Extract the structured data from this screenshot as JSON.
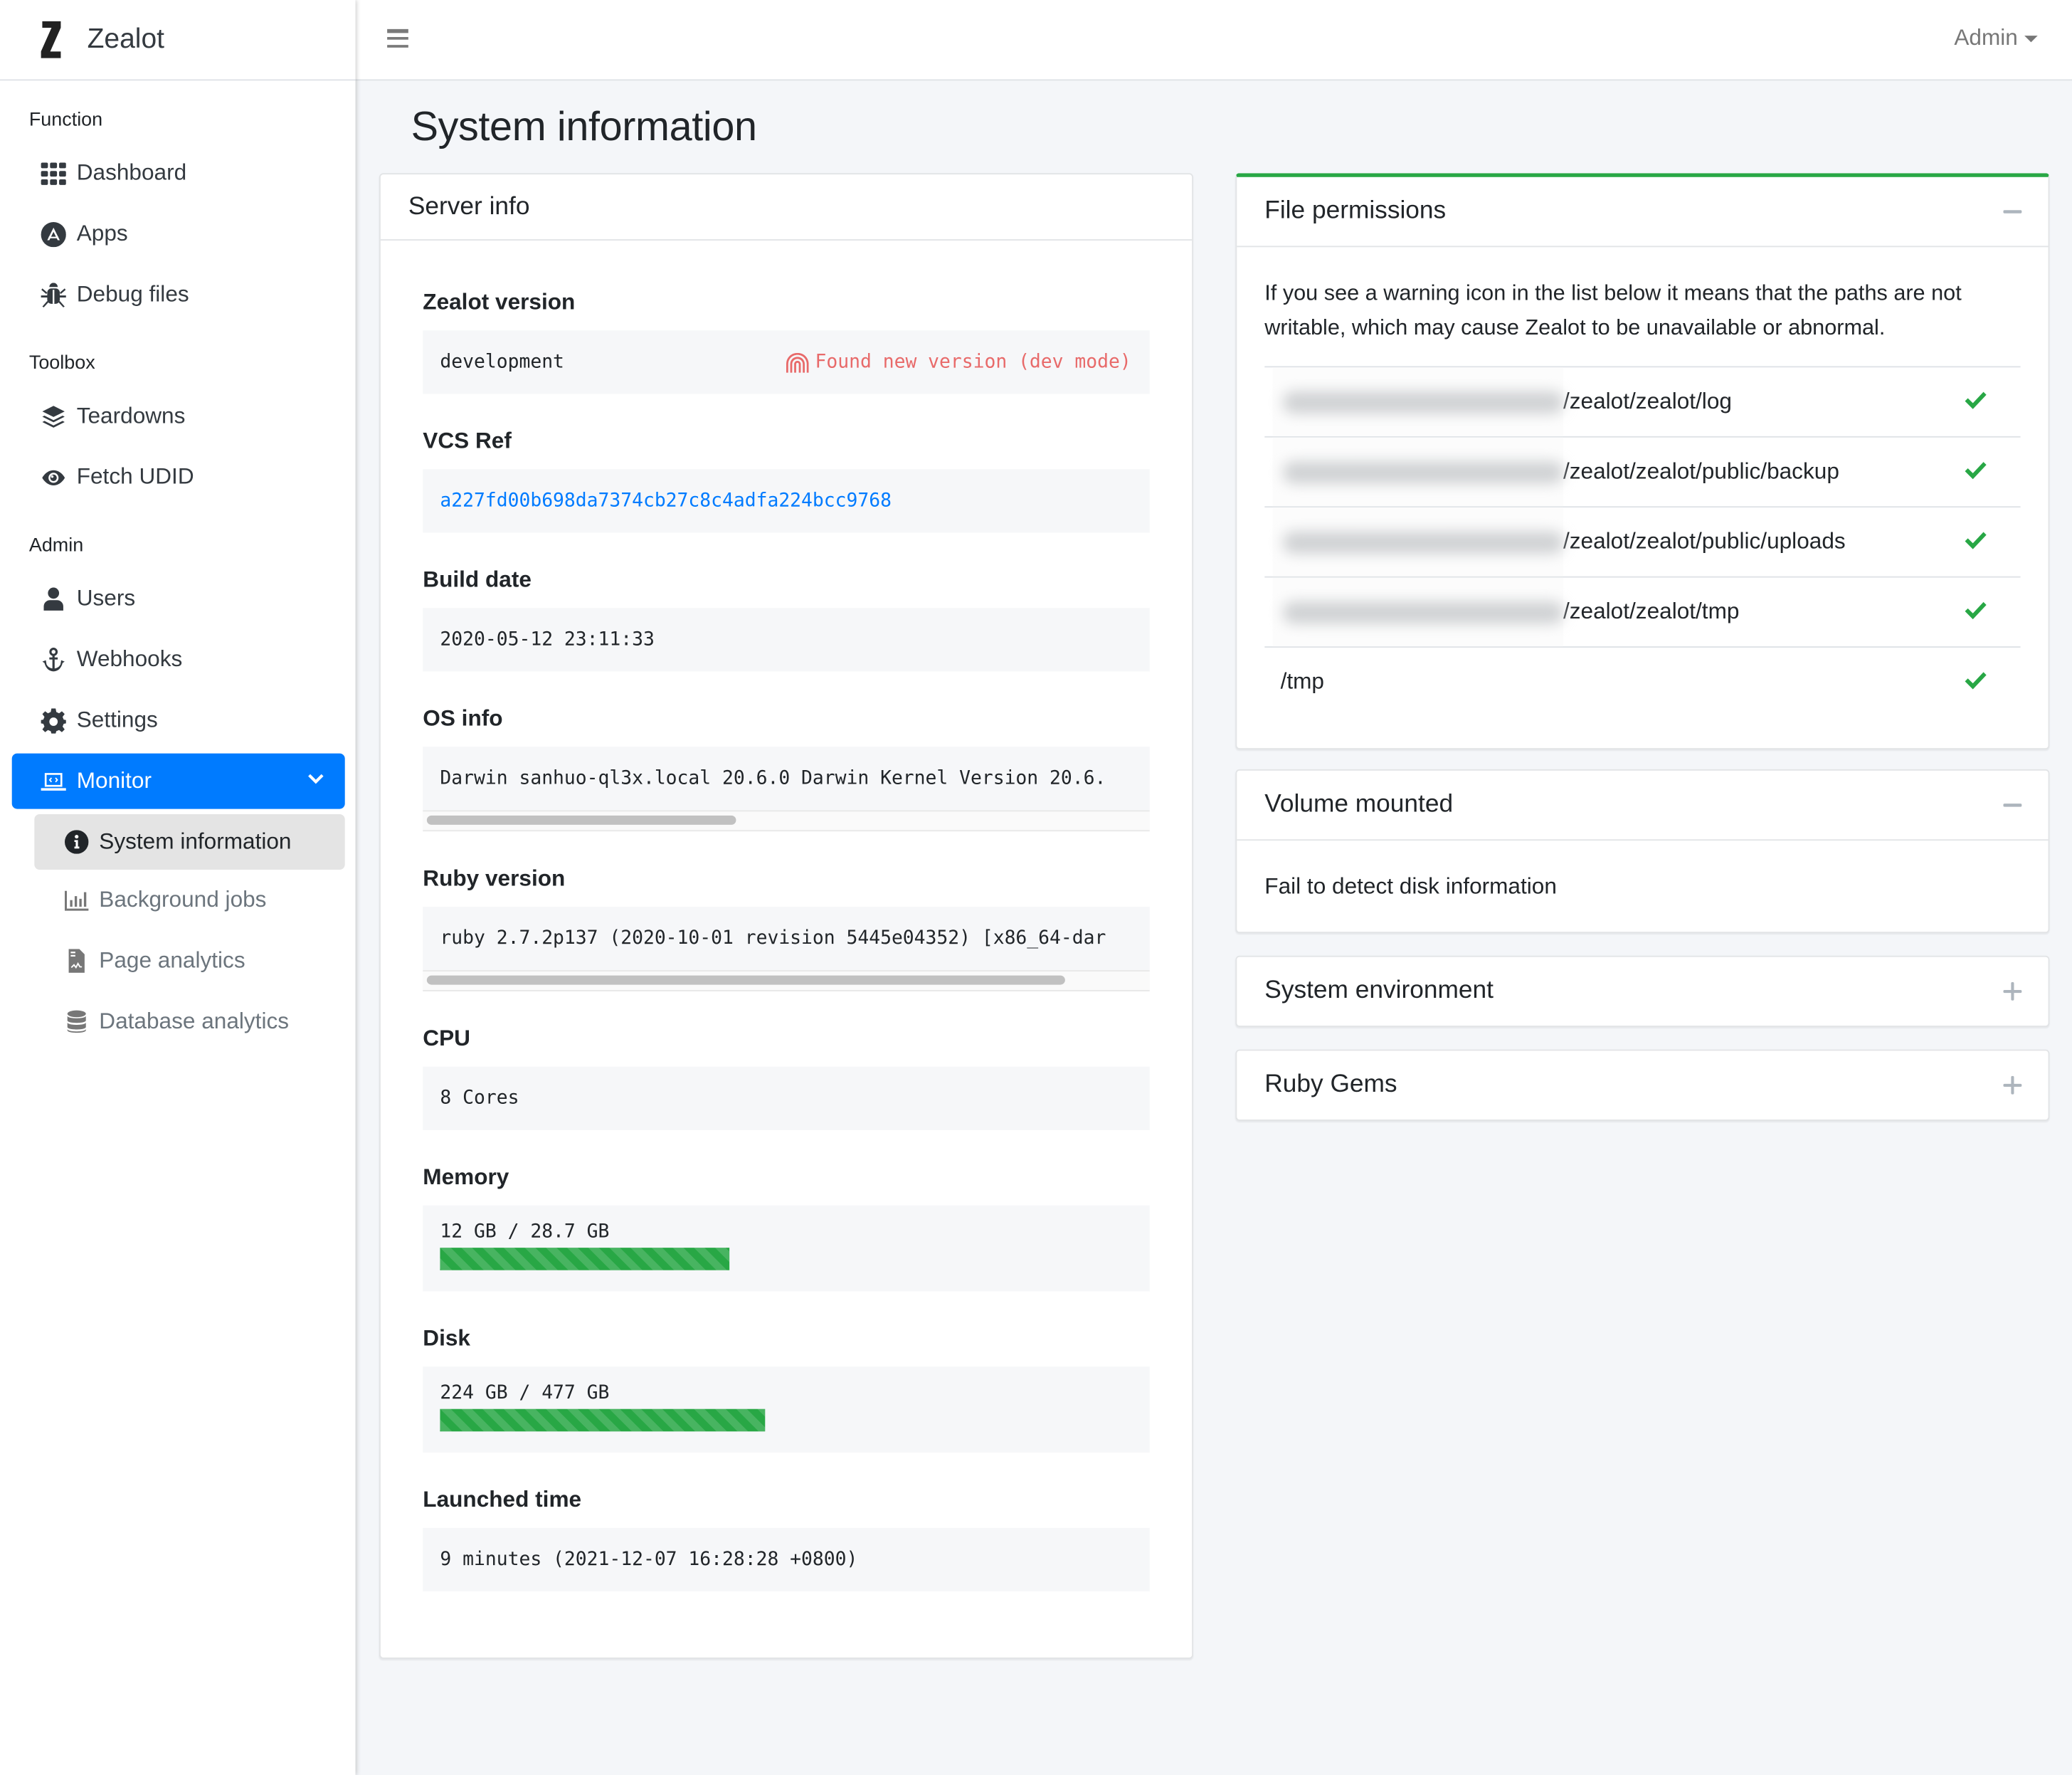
{
  "app": {
    "name": "Zealot",
    "logo_letter": "Z"
  },
  "topbar": {
    "menu_icon": "hamburger-icon",
    "user_menu_label": "Admin"
  },
  "sidebar": {
    "sections": [
      {
        "header": "Function",
        "items": [
          {
            "label": "Dashboard",
            "icon": "grid-icon"
          },
          {
            "label": "Apps",
            "icon": "app-store-icon"
          },
          {
            "label": "Debug files",
            "icon": "bug-icon"
          }
        ]
      },
      {
        "header": "Toolbox",
        "items": [
          {
            "label": "Teardowns",
            "icon": "layers-icon"
          },
          {
            "label": "Fetch UDID",
            "icon": "eye-icon"
          }
        ]
      },
      {
        "header": "Admin",
        "items": [
          {
            "label": "Users",
            "icon": "user-icon"
          },
          {
            "label": "Webhooks",
            "icon": "anchor-icon"
          },
          {
            "label": "Settings",
            "icon": "gear-icon"
          },
          {
            "label": "Monitor",
            "icon": "laptop-code-icon",
            "active": true,
            "expanded": true
          }
        ]
      }
    ],
    "monitor_children": [
      {
        "label": "System information",
        "icon": "info-circle-icon",
        "current": true
      },
      {
        "label": "Background jobs",
        "icon": "bar-chart-icon"
      },
      {
        "label": "Page analytics",
        "icon": "file-chart-icon"
      },
      {
        "label": "Database analytics",
        "icon": "database-icon"
      }
    ]
  },
  "page": {
    "title": "System information"
  },
  "server_info": {
    "title": "Server info",
    "zealot_version": {
      "label": "Zealot version",
      "value": "development",
      "notice": "Found new version (dev mode)"
    },
    "vcs_ref": {
      "label": "VCS Ref",
      "value": "a227fd00b698da7374cb27c8c4adfa224bcc9768"
    },
    "build_date": {
      "label": "Build date",
      "value": "2020-05-12 23:11:33"
    },
    "os_info": {
      "label": "OS info",
      "value": "Darwin sanhuo-ql3x.local 20.6.0 Darwin Kernel Version 20.6."
    },
    "ruby_version": {
      "label": "Ruby version",
      "value": "ruby 2.7.2p137 (2020-10-01 revision 5445e04352) [x86_64-dar"
    },
    "cpu": {
      "label": "CPU",
      "value": "8 Cores"
    },
    "memory": {
      "label": "Memory",
      "value": "12 GB / 28.7 GB",
      "used_percent": 41.8
    },
    "disk": {
      "label": "Disk",
      "value": "224 GB / 477 GB",
      "used_percent": 47.0
    },
    "launched_time": {
      "label": "Launched time",
      "value": "9 minutes (2021-12-07 16:28:28 +0800)"
    }
  },
  "file_permissions": {
    "title": "File permissions",
    "collapse_icon": "minus-icon",
    "intro": "If you see a warning icon in the list below it means that the paths are not writable, which may cause Zealot to be unavailable or abnormal.",
    "paths": [
      {
        "path": "/zealot/zealot/log",
        "redacted_prefix": true,
        "writable": true
      },
      {
        "path": "/zealot/zealot/public/backup",
        "redacted_prefix": true,
        "writable": true
      },
      {
        "path": "/zealot/zealot/public/uploads",
        "redacted_prefix": true,
        "writable": true
      },
      {
        "path": "/zealot/zealot/tmp",
        "redacted_prefix": true,
        "writable": true
      },
      {
        "path": "/tmp",
        "redacted_prefix": false,
        "writable": true
      }
    ]
  },
  "volume_mounted": {
    "title": "Volume mounted",
    "collapse_icon": "minus-icon",
    "message": "Fail to detect disk information"
  },
  "system_environment": {
    "title": "System environment",
    "expand_icon": "plus-icon"
  },
  "ruby_gems": {
    "title": "Ruby Gems",
    "expand_icon": "plus-icon"
  },
  "colors": {
    "primary": "#007bff",
    "success": "#28a745",
    "danger_text": "#e86a6a",
    "page_bg": "#f4f6f9"
  }
}
